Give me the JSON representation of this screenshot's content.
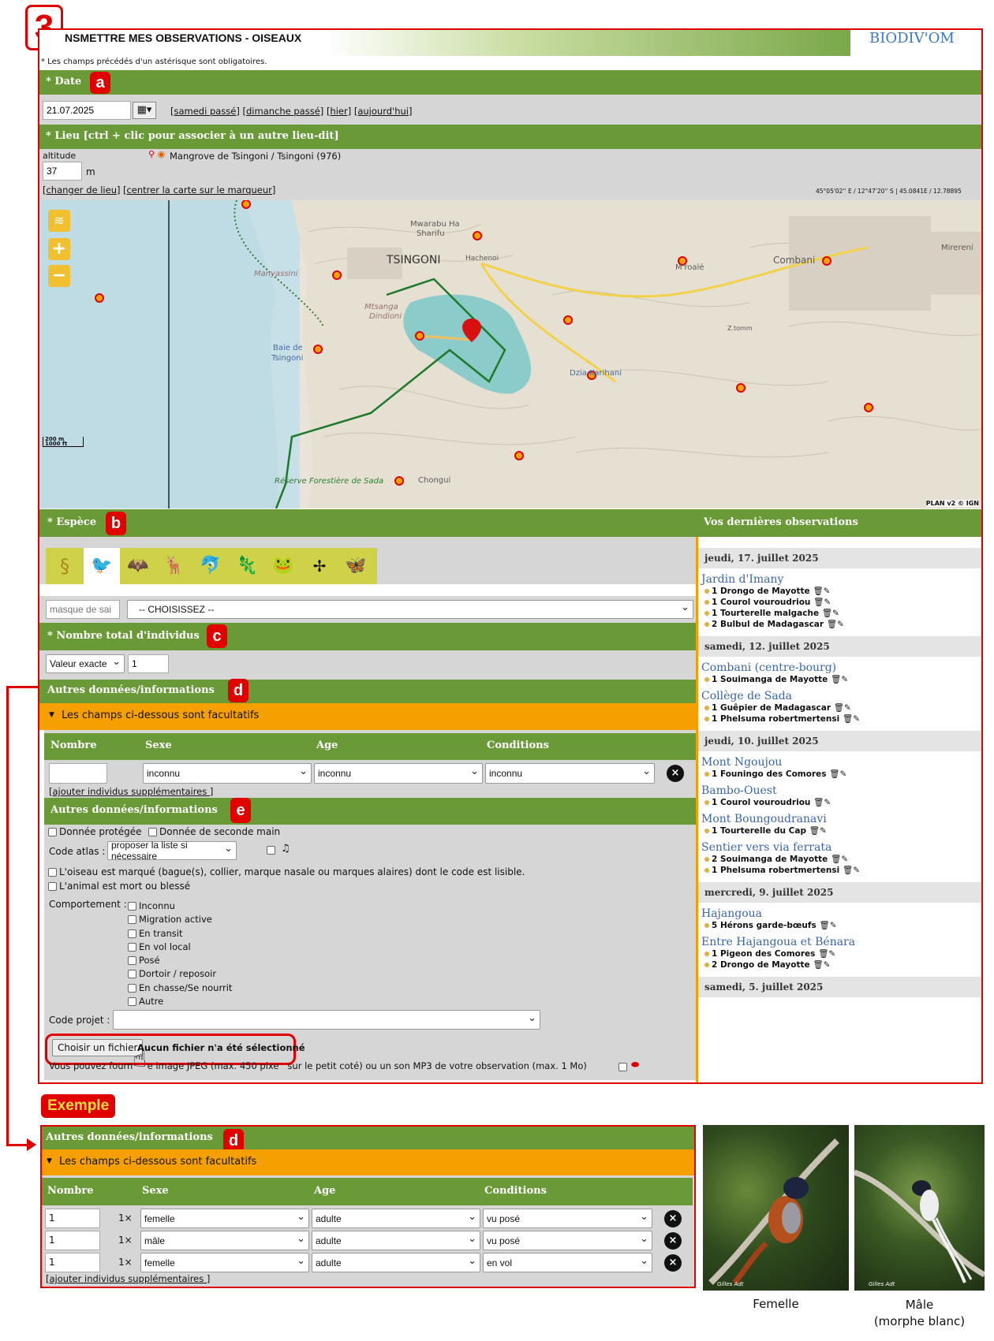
{
  "step_number": "3",
  "header": {
    "title": "NSMETTRE MES OBSERVATIONS - OISEAUX",
    "brand": "BIODIV'OM",
    "required_note": "* Les champs précédés d'un astérisque sont obligatoires."
  },
  "date_section": {
    "title": "* Date",
    "badge": "a",
    "value": "21.07.2025",
    "shortcuts": [
      "[samedi passé]",
      "[dimanche passé]",
      "[hier]",
      "[aujourd'hui]"
    ]
  },
  "lieu_section": {
    "title": "* Lieu [ctrl + clic pour associer à un autre lieu-dit]",
    "altitude_label": "altitude",
    "altitude_value": "37",
    "altitude_unit": "m",
    "place": "Mangrove de Tsingoni / Tsingoni (976)",
    "change_link": "[changer de lieu]",
    "center_link": "[centrer la carte sur le marqueur]",
    "coords": "45°05'02'' E / 12°47'20'' S | 45.0841E / 12.78895"
  },
  "map": {
    "labels": [
      "Mwarabu Ha Sharifu",
      "TSINGONI",
      "Hachenoi",
      "Manyassini",
      "Mtsanga Dindioni",
      "Baie de Tsingoni",
      "M'roalé",
      "Combani",
      "Mirereni",
      "Dzia Karihani",
      "Z.tomm",
      "Réserve Forestière de Sada",
      "Chongui"
    ],
    "scale_m": "200 m",
    "scale_ft": "1000 ft",
    "attribution": "PLAN v2 © IGN"
  },
  "espece_section": {
    "title": "* Espèce",
    "badge": "b",
    "mask_placeholder": "masque de sai",
    "select_value": "-- CHOISISSEZ --",
    "groups": [
      "dna-icon",
      "bird-icon",
      "bat-icon",
      "deer-icon",
      "dolphin-icon",
      "lizard-icon",
      "frog-icon",
      "dragonfly-icon",
      "butterfly-icon"
    ]
  },
  "nombre_section": {
    "title": "* Nombre total d'individus",
    "badge": "c",
    "mode": "Valeur exacte",
    "value": "1"
  },
  "autres_section": {
    "title": "Autres données/informations",
    "badge": "d",
    "optional": "Les champs ci-dessous sont facultatifs",
    "columns": [
      "Nombre",
      "Sexe",
      "Age",
      "Conditions"
    ],
    "row": {
      "sexe": "inconnu",
      "age": "inconnu",
      "conditions": "inconnu"
    },
    "add_link": "[ajouter individus supplémentaires ]"
  },
  "extra_section": {
    "title": "Autres données/informations",
    "badge": "e",
    "protected": "Donnée protégée",
    "second_hand": "Donnée de seconde main",
    "atlas_label": "Code atlas :",
    "atlas_value": "proposer la liste si nécessaire",
    "marked": "L'oiseau est marqué (bague(s), collier, marque nasale ou marques alaires) dont le code est lisible.",
    "dead": "L'animal est mort ou blessé",
    "behaviour_label": "Comportement :",
    "behaviours": [
      "Inconnu",
      "Migration active",
      "En transit",
      "En vol local",
      "Posé",
      "Dortoir / reposoir",
      "En chasse/Se nourrit",
      "Autre"
    ],
    "project_label": "Code projet :",
    "file_button": "Choisir un fichier",
    "file_status": "Aucun fichier n'a été sélectionné",
    "file_note": "Vous pouvez fourn     e image JPEG (max. 450 pixe   sur le petit coté) ou un son MP3 de votre observation (max. 1 Mo)"
  },
  "sidebar": {
    "title": "Vos dernières observations",
    "days": [
      {
        "date": "jeudi, 17. juillet 2025",
        "places": [
          {
            "name": "Jardin d'Imany",
            "items": [
              "1 Drongo de Mayotte",
              "1 Courol vouroudriou",
              "1 Tourterelle malgache",
              "2 Bulbul de Madagascar"
            ]
          }
        ]
      },
      {
        "date": "samedi, 12. juillet 2025",
        "places": [
          {
            "name": "Combani (centre-bourg)",
            "items": [
              "1 Souimanga de Mayotte"
            ]
          },
          {
            "name": "Collège de Sada",
            "items": [
              "1 Guêpier de Madagascar",
              "1 Phelsuma robertmertensi"
            ]
          }
        ]
      },
      {
        "date": "jeudi, 10. juillet 2025",
        "places": [
          {
            "name": "Mont Ngoujou",
            "items": [
              "1 Founingo des Comores"
            ]
          },
          {
            "name": "Bambo-Ouest",
            "items": [
              "1 Courol vouroudriou"
            ]
          },
          {
            "name": "Mont Boungoudranavi",
            "items": [
              "1 Tourterelle du Cap"
            ]
          },
          {
            "name": "Sentier vers via ferrata",
            "items": [
              "2 Souimanga de Mayotte",
              "1 Phelsuma robertmertensi"
            ]
          }
        ]
      },
      {
        "date": "mercredi, 9. juillet 2025",
        "places": [
          {
            "name": "Hajangoua",
            "items": [
              "5 Hérons garde-bœufs"
            ]
          },
          {
            "name": "Entre Hajangoua et Bénara",
            "items": [
              "1 Pigeon des Comores",
              "2 Drongo de Mayotte"
            ]
          }
        ]
      },
      {
        "date": "samedi, 5. juillet 2025",
        "places": []
      }
    ]
  },
  "example": {
    "label": "Exemple",
    "title": "Autres données/informations",
    "badge": "d",
    "optional": "Les champs ci-dessous sont facultatifs",
    "columns": [
      "Nombre",
      "Sexe",
      "Age",
      "Conditions"
    ],
    "rows": [
      {
        "nombre": "1",
        "mult": "1×",
        "sexe": "femelle",
        "age": "adulte",
        "conditions": "vu posé"
      },
      {
        "nombre": "1",
        "mult": "1×",
        "sexe": "mâle",
        "age": "adulte",
        "conditions": "vu posé"
      },
      {
        "nombre": "1",
        "mult": "1×",
        "sexe": "femelle",
        "age": "adulte",
        "conditions": "en vol"
      }
    ],
    "add_link": "[ajouter individus supplémentaires ]"
  },
  "photos": [
    {
      "caption": "Femelle",
      "credit": "Gilles Adt"
    },
    {
      "caption": "Mâle\n(morphe blanc)",
      "credit": "Gilles Adt"
    }
  ]
}
